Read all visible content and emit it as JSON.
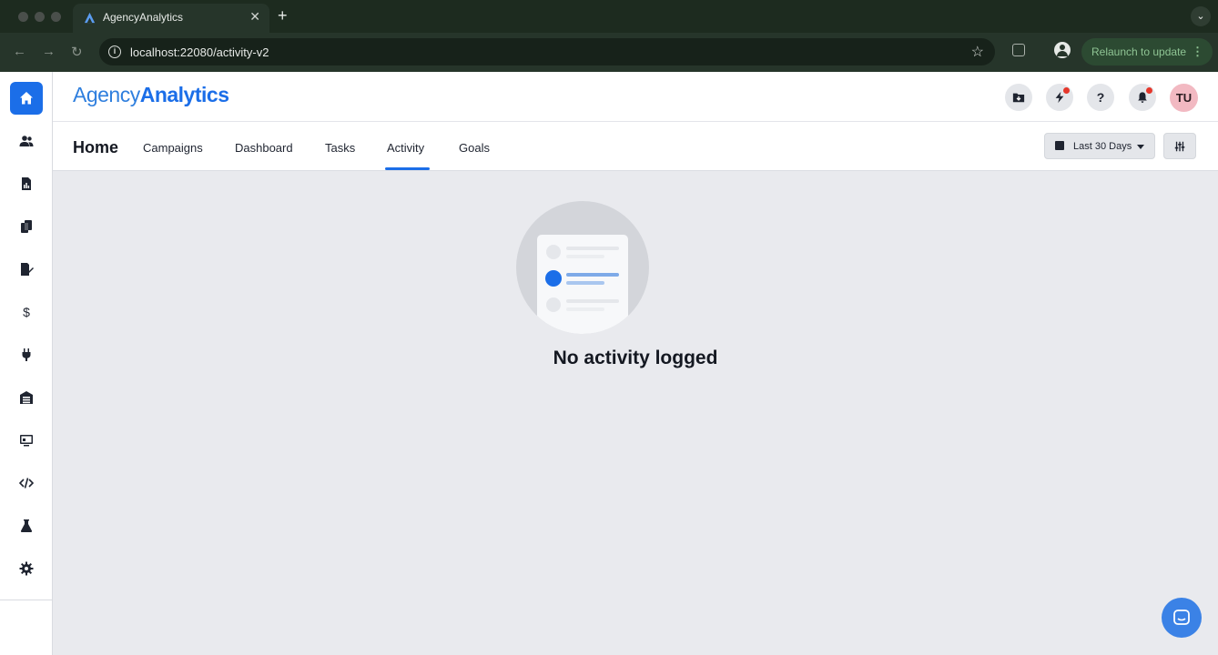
{
  "browser": {
    "tab_title": "AgencyAnalytics",
    "url": "localhost:22080/activity-v2",
    "relaunch_label": "Relaunch to update"
  },
  "brand": {
    "logo_light": "Agency",
    "logo_bold": "Analytics",
    "accent": "#1b6ee8"
  },
  "sidebar": {
    "items": [
      {
        "icon": "home-icon",
        "active": true
      },
      {
        "icon": "users-icon"
      },
      {
        "icon": "report-icon"
      },
      {
        "icon": "copy-icon"
      },
      {
        "icon": "edit-document-icon"
      },
      {
        "icon": "dollar-icon"
      },
      {
        "icon": "plug-icon"
      },
      {
        "icon": "warehouse-icon"
      },
      {
        "icon": "monitor-icon"
      },
      {
        "icon": "code-icon"
      },
      {
        "icon": "flask-icon"
      },
      {
        "icon": "gear-icon"
      }
    ]
  },
  "header": {
    "avatar_initials": "TU",
    "help_label": "?"
  },
  "subnav": {
    "title": "Home",
    "tabs": [
      "Campaigns",
      "Dashboard",
      "Tasks",
      "Activity",
      "Goals"
    ],
    "active_tab": "Activity",
    "date_range": "Last 30 Days"
  },
  "main": {
    "empty_message": "No activity logged"
  }
}
